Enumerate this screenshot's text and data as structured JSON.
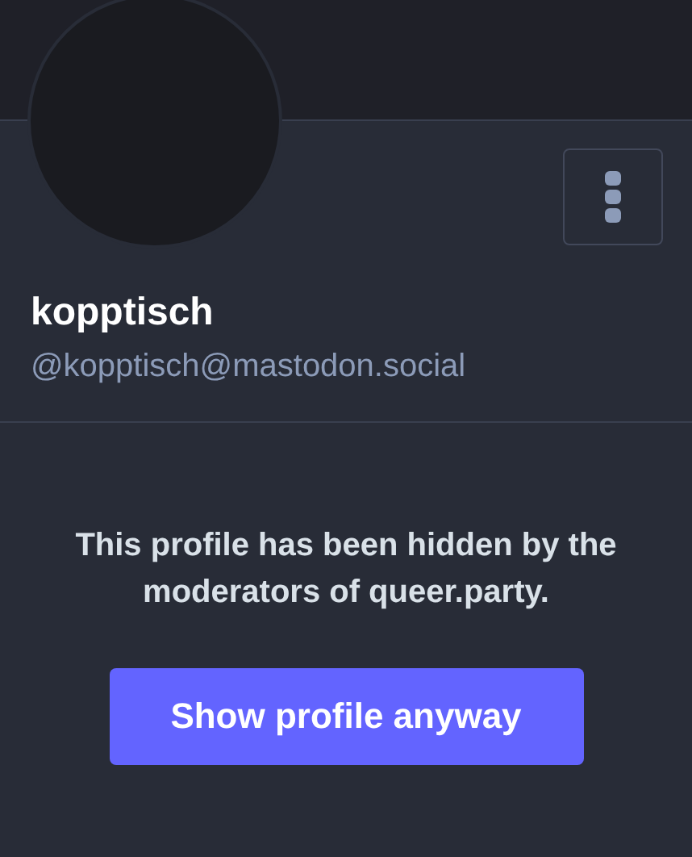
{
  "profile": {
    "display_name": "kopptisch",
    "handle": "@kopptisch@mastodon.social"
  },
  "notice": {
    "message": "This profile has been hidden by the moderators of queer.party.",
    "button": "Show profile anyway"
  }
}
